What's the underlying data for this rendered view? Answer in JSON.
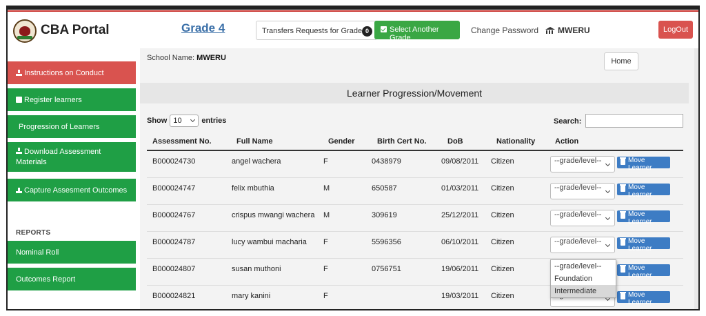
{
  "header": {
    "brand": "CBA Portal",
    "grade": "Grade 4",
    "transfers_label": "Transfers Requests for Grade 4",
    "transfers_count": "0",
    "select_grade": "Select Another Grade",
    "change_password": "Change Password",
    "school_user": "MWERU",
    "logout": "LogOut"
  },
  "sidebar": {
    "instructions": "Instructions on Conduct",
    "register": "Register learners",
    "progression": "Progression of Learners",
    "download_line1": "Download Assessment",
    "download_line2": "Materials",
    "capture": "Capture Assesment Outcomes",
    "reports_heading": "REPORTS",
    "nominal_roll": "Nominal Roll",
    "outcomes_report": "Outcomes Report"
  },
  "main": {
    "school_label": "School Name:",
    "school_value": "MWERU",
    "home": "Home",
    "panel_title": "Learner Progression/Movement",
    "show_label": "Show",
    "show_value": "10",
    "entries_label": "entries",
    "search_label": "Search:"
  },
  "table": {
    "headers": [
      "Assessment No.",
      "Full Name",
      "Gender",
      "Birth Cert No.",
      "DoB",
      "Nationality",
      "Action"
    ],
    "rows": [
      [
        "B000024730",
        "angel wachera",
        "F",
        "0438979",
        "09/08/2011",
        "Citizen"
      ],
      [
        "B000024747",
        "felix mbuthia",
        "M",
        "650587",
        "01/03/2011",
        "Citizen"
      ],
      [
        "B000024767",
        "crispus mwangi wachera",
        "M",
        "309619",
        "25/12/2011",
        "Citizen"
      ],
      [
        "B000024787",
        "lucy wambui macharia",
        "F",
        "5596356",
        "06/10/2011",
        "Citizen"
      ],
      [
        "B000024807",
        "susan muthoni",
        "F",
        "0756751",
        "19/06/2011",
        "Citizen"
      ],
      [
        "B000024821",
        "mary kanini",
        "F",
        "",
        "19/03/2011",
        "Citizen"
      ]
    ],
    "grade_select": "--grade/level--",
    "move_button": "Move Learner"
  },
  "dropdown": {
    "options": [
      "--grade/level--",
      "Foundation",
      "Intermediate"
    ],
    "highlighted": "Intermediate"
  },
  "colors": {
    "green": "#1f9f45",
    "red": "#d9534f",
    "blue": "#3d7cc4",
    "grade_link": "#3a6fa8"
  }
}
